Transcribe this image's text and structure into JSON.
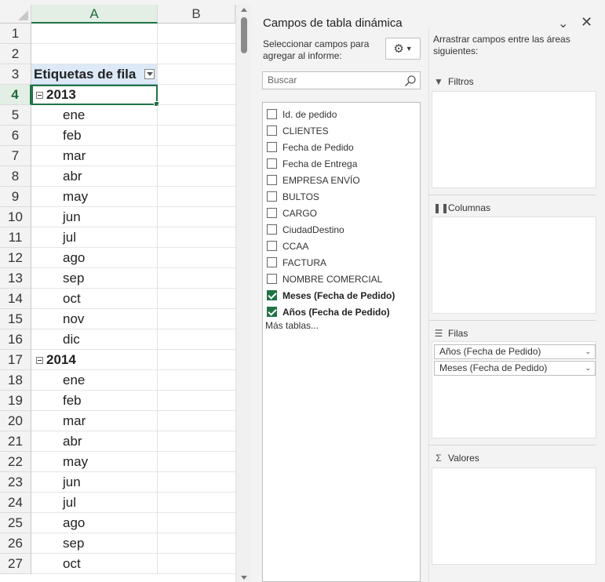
{
  "sheet": {
    "columns": [
      "A",
      "B"
    ],
    "row_header_label": "Etiquetas de fila",
    "rows": [
      {
        "num": "1",
        "text": "",
        "kind": "blank"
      },
      {
        "num": "2",
        "text": "",
        "kind": "blank"
      },
      {
        "num": "3",
        "text": "Etiquetas de fila",
        "kind": "header"
      },
      {
        "num": "4",
        "text": "2013",
        "kind": "year"
      },
      {
        "num": "5",
        "text": "ene",
        "kind": "month"
      },
      {
        "num": "6",
        "text": "feb",
        "kind": "month"
      },
      {
        "num": "7",
        "text": "mar",
        "kind": "month"
      },
      {
        "num": "8",
        "text": "abr",
        "kind": "month"
      },
      {
        "num": "9",
        "text": "may",
        "kind": "month"
      },
      {
        "num": "10",
        "text": "jun",
        "kind": "month"
      },
      {
        "num": "11",
        "text": "jul",
        "kind": "month"
      },
      {
        "num": "12",
        "text": "ago",
        "kind": "month"
      },
      {
        "num": "13",
        "text": "sep",
        "kind": "month"
      },
      {
        "num": "14",
        "text": "oct",
        "kind": "month"
      },
      {
        "num": "15",
        "text": "nov",
        "kind": "month"
      },
      {
        "num": "16",
        "text": "dic",
        "kind": "month"
      },
      {
        "num": "17",
        "text": "2014",
        "kind": "year"
      },
      {
        "num": "18",
        "text": "ene",
        "kind": "month"
      },
      {
        "num": "19",
        "text": "feb",
        "kind": "month"
      },
      {
        "num": "20",
        "text": "mar",
        "kind": "month"
      },
      {
        "num": "21",
        "text": "abr",
        "kind": "month"
      },
      {
        "num": "22",
        "text": "may",
        "kind": "month"
      },
      {
        "num": "23",
        "text": "jun",
        "kind": "month"
      },
      {
        "num": "24",
        "text": "jul",
        "kind": "month"
      },
      {
        "num": "25",
        "text": "ago",
        "kind": "month"
      },
      {
        "num": "26",
        "text": "sep",
        "kind": "month"
      },
      {
        "num": "27",
        "text": "oct",
        "kind": "month"
      }
    ],
    "active_row": "4",
    "accent_color": "#217346"
  },
  "pane": {
    "title": "Campos de tabla dinámica",
    "choose_label": "Seleccionar campos para agregar al informe:",
    "search_placeholder": "Buscar",
    "fields": [
      {
        "label": "Id. de pedido",
        "checked": false
      },
      {
        "label": "CLIENTES",
        "checked": false
      },
      {
        "label": "Fecha de Pedido",
        "checked": false
      },
      {
        "label": "Fecha de Entrega",
        "checked": false
      },
      {
        "label": "EMPRESA ENVÍO",
        "checked": false
      },
      {
        "label": "BULTOS",
        "checked": false
      },
      {
        "label": "CARGO",
        "checked": false
      },
      {
        "label": "CiudadDestino",
        "checked": false
      },
      {
        "label": "CCAA",
        "checked": false
      },
      {
        "label": "FACTURA",
        "checked": false
      },
      {
        "label": "NOMBRE COMERCIAL",
        "checked": false
      },
      {
        "label": "Meses (Fecha de Pedido)",
        "checked": true
      },
      {
        "label": "Años (Fecha de Pedido)",
        "checked": true
      }
    ],
    "more_tables": "Más tablas...",
    "drag_label": "Arrastrar campos entre las áreas siguientes:",
    "areas": {
      "filters": {
        "label": "Filtros",
        "icon": "filter-icon",
        "items": []
      },
      "columns": {
        "label": "Columnas",
        "icon": "columns-icon",
        "items": []
      },
      "rows": {
        "label": "Filas",
        "icon": "rows-icon",
        "items": [
          "Años (Fecha de Pedido)",
          "Meses (Fecha de Pedido)"
        ]
      },
      "values": {
        "label": "Valores",
        "icon": "sigma-icon",
        "items": []
      }
    }
  }
}
